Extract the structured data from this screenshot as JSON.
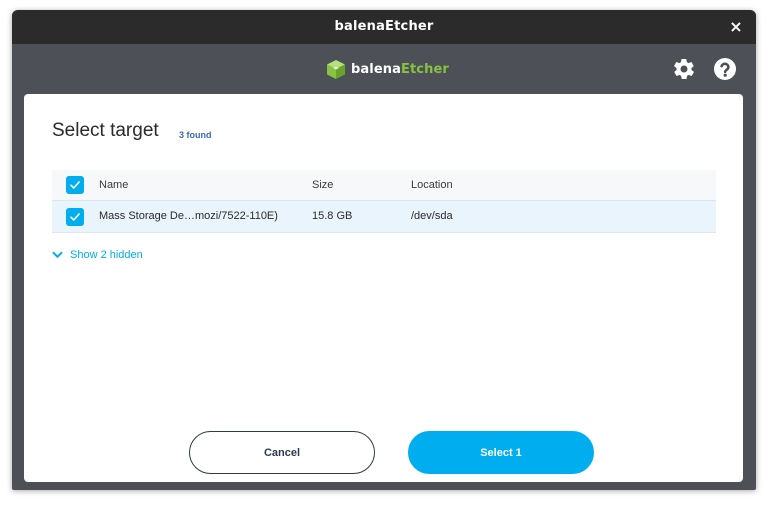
{
  "window": {
    "title": "balenaEtcher",
    "close_glyph": "×"
  },
  "header": {
    "brand_part1": "balena",
    "brand_part2": "Etcher",
    "logo_icon": "balena-cube-icon",
    "settings_icon": "gear-icon",
    "help_icon": "help-circle-icon",
    "colors": {
      "brand_green": "#85c340",
      "header_bg": "#4d5057"
    }
  },
  "dialog": {
    "title": "Select target",
    "found_label": "3 found",
    "table": {
      "columns": [
        "Name",
        "Size",
        "Location"
      ],
      "header_checked": true,
      "rows": [
        {
          "checked": true,
          "name": "Mass Storage De…mozi/7522-110E)",
          "size": "15.8 GB",
          "location": "/dev/sda"
        }
      ]
    },
    "show_hidden_label": "Show 2 hidden",
    "cancel_label": "Cancel",
    "select_label": "Select 1",
    "colors": {
      "accent": "#00aeef",
      "row_selected_bg": "#e9f4fc"
    }
  }
}
